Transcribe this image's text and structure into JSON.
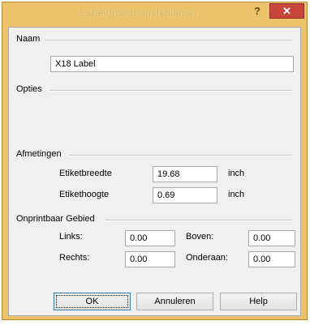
{
  "window": {
    "title": "Labelgrootte-instellingen",
    "help_glyph": "?",
    "close_glyph": "✕"
  },
  "naam": {
    "group_label": "Naam",
    "value": "X18 Label"
  },
  "opties": {
    "group_label": "Opties"
  },
  "afmetingen": {
    "group_label": "Afmetingen",
    "width_label": "Etiketbreedte",
    "width_value": "19.68",
    "width_unit": "inch",
    "height_label": "Etikethoogte",
    "height_value": "0.69",
    "height_unit": "inch"
  },
  "onprintbaar": {
    "group_label": "Onprintbaar Gebied",
    "left_label": "Links:",
    "left_value": "0.00",
    "top_label": "Boven:",
    "top_value": "0.00",
    "right_label": "Rechts:",
    "right_value": "0.00",
    "bottom_label": "Onderaan:",
    "bottom_value": "0.00"
  },
  "buttons": {
    "ok": "OK",
    "cancel": "Annuleren",
    "help": "Help"
  },
  "colors": {
    "title_bar": "#ecc36a",
    "close_button": "#c8463a",
    "client_bg": "#f0f0f0"
  }
}
